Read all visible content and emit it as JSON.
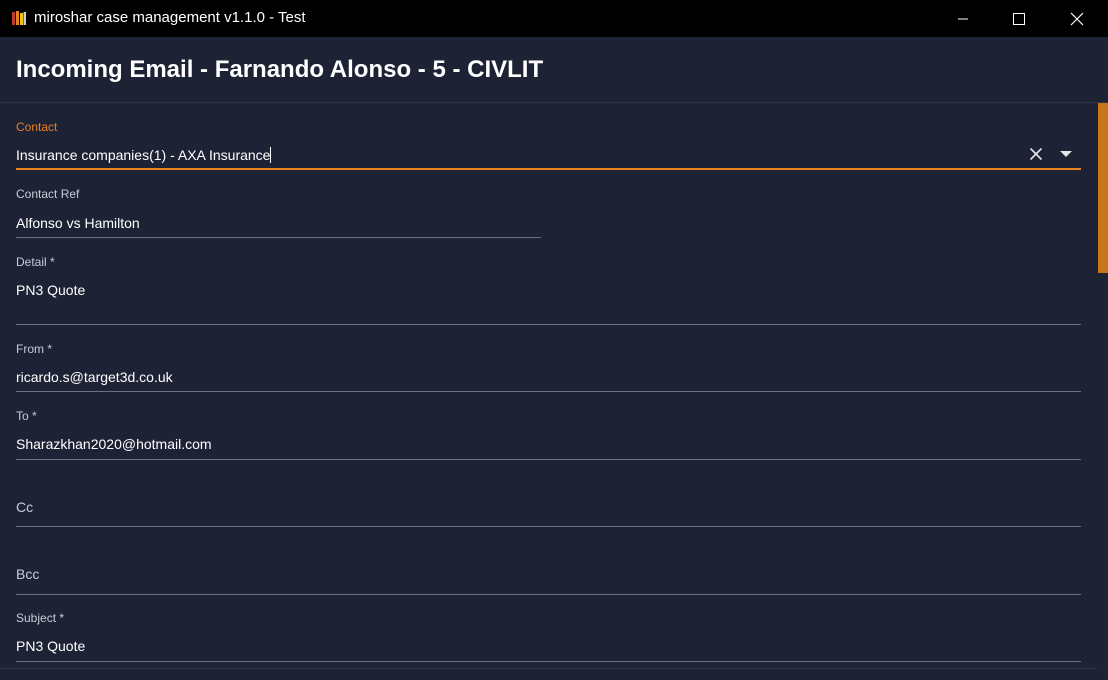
{
  "window": {
    "title": "miroshar case management v1.1.0 - Test"
  },
  "page": {
    "title": "Incoming Email - Farnando Alonso - 5 - CIVLIT"
  },
  "form": {
    "contact": {
      "label": "Contact",
      "value": "Insurance companies(1) - AXA Insurance"
    },
    "contact_ref": {
      "label": "Contact Ref",
      "value": "Alfonso vs Hamilton"
    },
    "detail": {
      "label": "Detail *",
      "value": "PN3 Quote"
    },
    "from": {
      "label": "From *",
      "value": "ricardo.s@target3d.co.uk"
    },
    "to": {
      "label": "To *",
      "value": "Sharazkhan2020@hotmail.com"
    },
    "cc": {
      "label": "Cc",
      "value": ""
    },
    "bcc": {
      "label": "Bcc",
      "value": ""
    },
    "subject": {
      "label": "Subject *",
      "value": "PN3 Quote"
    }
  },
  "colors": {
    "background": "#1e2235",
    "titlebar": "#000000",
    "accent": "#e8821e",
    "underline": "#6b6f80"
  },
  "icons": {
    "app": "books-icon",
    "clear": "close-icon",
    "dropdown": "caret-down-icon"
  }
}
